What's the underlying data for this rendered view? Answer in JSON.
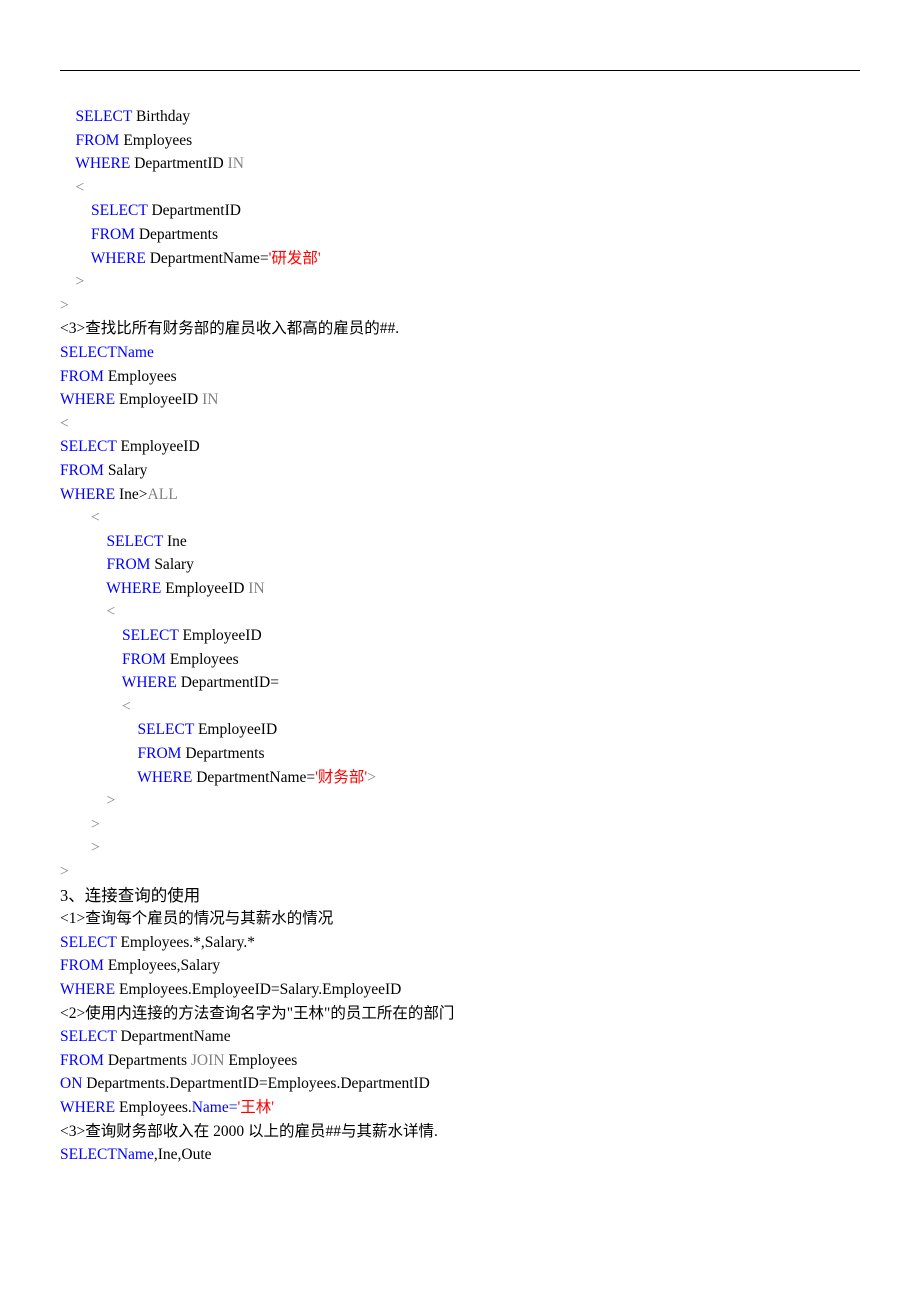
{
  "l1": "SELECT",
  "l1b": " Birthday",
  "l2": "FROM",
  "l2b": " Employees",
  "l3": "WHERE",
  "l3b": " DepartmentID ",
  "l3c": "IN",
  "l4": "<",
  "l5": "SELECT",
  "l5b": " DepartmentID",
  "l6": "FROM",
  "l6b": " Departments",
  "l7": "WHERE",
  "l7b": " DepartmentName=",
  "l7c": "'研发部'",
  "l8": ">",
  "l9": ">",
  "q3": "<3>查找比所有财务部的雇员收入都高的雇员的##.",
  "l10": "SELECTName",
  "l11": "FROM",
  "l11b": " Employees",
  "l12": "WHERE",
  "l12b": " EmployeeID ",
  "l12c": "IN",
  "l13": "<",
  "l14": "SELECT",
  "l14b": " EmployeeID",
  "l15": "FROM",
  "l15b": " Salary",
  "l16": "WHERE",
  "l16b": " Ine>",
  "l16c": "ALL",
  "l17": "<",
  "l18": "SELECT",
  "l18b": " Ine",
  "l19": "FROM",
  "l19b": " Salary",
  "l20": "WHERE",
  "l20b": " EmployeeID ",
  "l20c": "IN",
  "l21": "<",
  "l22": "SELECT",
  "l22b": " EmployeeID",
  "l23": "FROM",
  "l23b": " Employees",
  "l24": "WHERE",
  "l24b": " DepartmentID=",
  "l25": "<",
  "l26": "SELECT",
  "l26b": " EmployeeID",
  "l27": "FROM",
  "l27b": " Departments",
  "l28": "WHERE",
  "l28b": " DepartmentName=",
  "l28c": "'财务部'",
  "l28d": ">",
  "l29": ">",
  "l30": ">",
  "l31": ">",
  "l32": ">",
  "hd3": "3、连接查询的使用",
  "j1": "<1>查询每个雇员的情况与其薪水的情况",
  "j2": "SELECT",
  "j2b": " Employees.*,Salary.*",
  "j3": "FROM",
  "j3b": " Employees,Salary",
  "j4": "WHERE",
  "j4b": " Employees.EmployeeID=Salary.EmployeeID",
  "j5": "<2>使用内连接的方法查询名字为\"王林\"的员工所在的部门",
  "j6": "SELECT",
  "j6b": " DepartmentName",
  "j7": "FROM",
  "j7b": " Departments ",
  "j7c": "JOIN",
  "j7d": " Employees",
  "j8": "ON",
  "j8b": " Departments.DepartmentID=Employees.DepartmentID",
  "j9": "WHERE",
  "j9b": " Employees.",
  "j9c": "Name=",
  "j9d": "'王林'",
  "j10": "<3>查询财务部收入在 2000 以上的雇员##与其薪水详情.",
  "j11": "SELECTName",
  "j11b": ",Ine,Oute"
}
